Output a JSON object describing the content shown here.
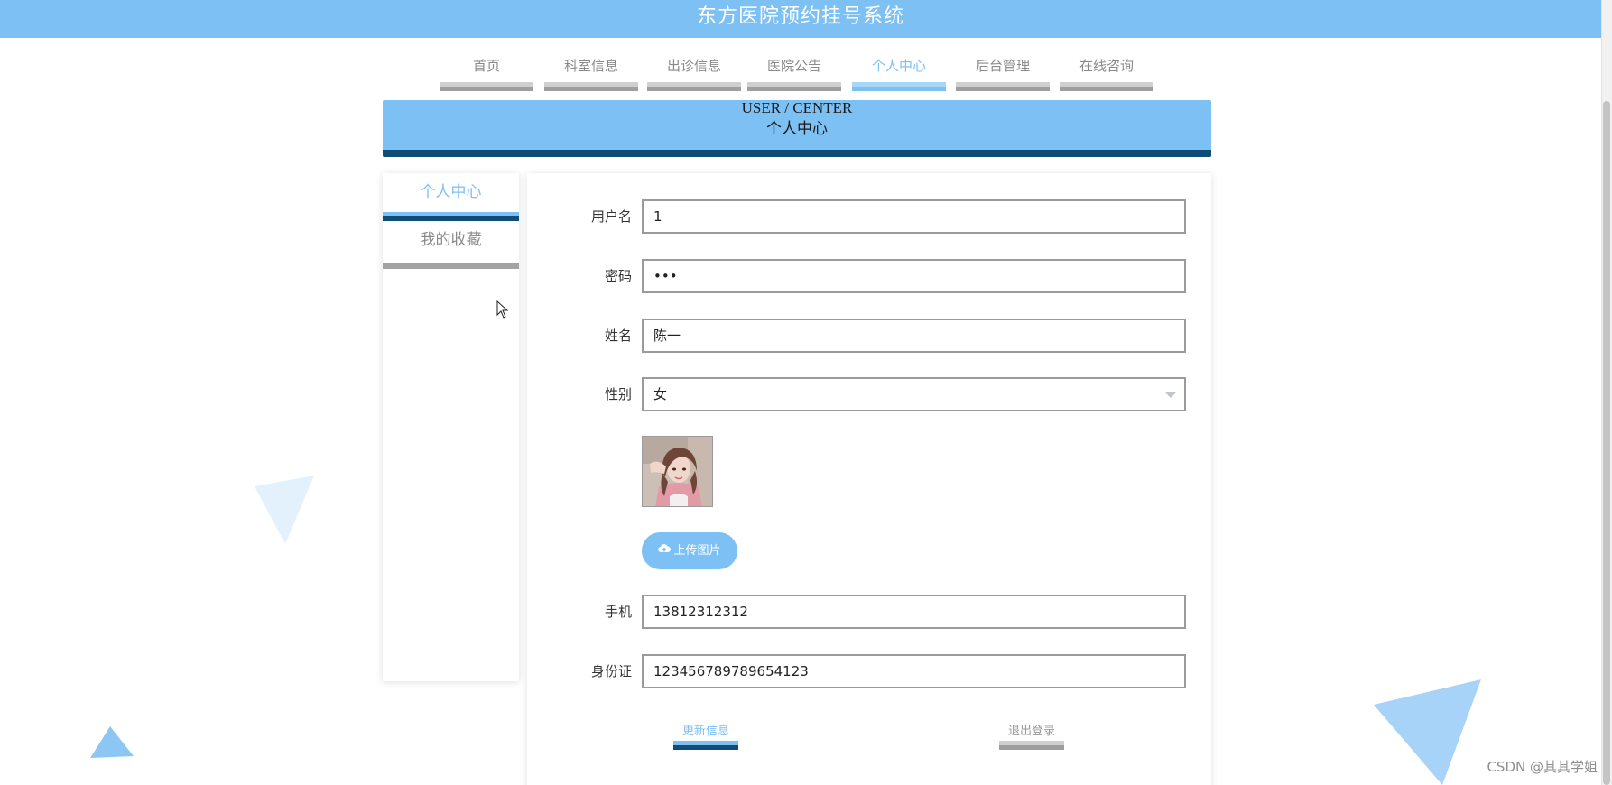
{
  "header": {
    "title": "东方医院预约挂号系统"
  },
  "nav": {
    "items": [
      {
        "label": "首页",
        "active": false
      },
      {
        "label": "科室信息",
        "active": false
      },
      {
        "label": "出诊信息",
        "active": false
      },
      {
        "label": "医院公告",
        "active": false
      },
      {
        "label": "个人中心",
        "active": true
      },
      {
        "label": "后台管理",
        "active": false
      },
      {
        "label": "在线咨询",
        "active": false
      }
    ]
  },
  "banner": {
    "en": "USER / CENTER",
    "zh": "个人中心"
  },
  "sidebar": {
    "items": [
      {
        "label": "个人中心",
        "active": true
      },
      {
        "label": "我的收藏",
        "active": false
      }
    ]
  },
  "form": {
    "username": {
      "label": "用户名",
      "value": "1"
    },
    "password": {
      "label": "密码",
      "value": "•••"
    },
    "name": {
      "label": "姓名",
      "value": "陈一"
    },
    "gender": {
      "label": "性别",
      "value": "女"
    },
    "upload_label": "上传图片",
    "phone": {
      "label": "手机",
      "value": "13812312312"
    },
    "id_card": {
      "label": "身份证",
      "value": "123456789789654123"
    }
  },
  "actions": {
    "update": "更新信息",
    "logout": "退出登录"
  },
  "watermark": "CSDN @其其学姐",
  "colors": {
    "accent": "#7dc0f4",
    "dark": "#0f4c78",
    "muted": "#9e9e9e"
  },
  "icons": {
    "upload": "cloud-upload-icon",
    "select": "chevron-down-icon",
    "pointer": "mouse-pointer-icon"
  }
}
